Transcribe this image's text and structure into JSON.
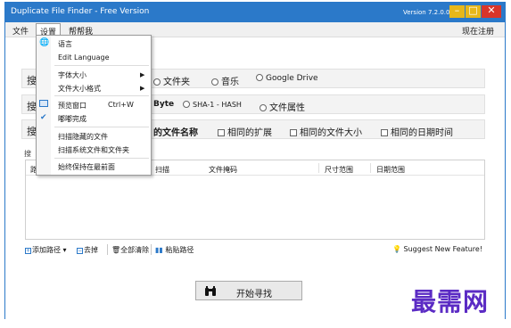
{
  "window": {
    "title": "Duplicate File Finder - Free Version",
    "version": "Version 7.2.0.0"
  },
  "menu": {
    "file": "文件",
    "settings": "设置",
    "help": "帮帮我",
    "register": "现在注册"
  },
  "search_rows": {
    "row1_label": "搜",
    "row1_options": [
      "文件夹",
      "音乐",
      "Google Drive"
    ],
    "row2_label": "搜",
    "row2_options": [
      "Byte",
      "SHA-1 - HASH",
      "文件属性"
    ],
    "row3_label": "搜",
    "row3_options": [
      "的文件名称",
      "相同的扩展",
      "相同的文件大小",
      "相同的日期时间"
    ]
  },
  "group_title": "搜",
  "table": {
    "headers": [
      "路",
      "扫描",
      "文件掩码",
      "尺寸范围",
      "日期范围"
    ]
  },
  "toolbar": {
    "add_path": "添加路径",
    "remove": "去掉",
    "clear_all": "全部清除",
    "paste_path": "粘贴路径",
    "suggest": "Suggest New Feature!"
  },
  "start_button": "开始寻找",
  "watermark": "最需网",
  "settings_menu": {
    "language": "语言",
    "edit_language": "Edit Language",
    "font_size": "字体大小",
    "file_size_format": "文件大小格式",
    "preview_window": "预览窗口",
    "preview_shortcut": "Ctrl+W",
    "beep_done": "嘟嘟完成",
    "scan_hidden": "扫描隐藏的文件",
    "scan_system": "扫描系统文件和文件夹",
    "always_on_top": "始终保持在最前面"
  }
}
